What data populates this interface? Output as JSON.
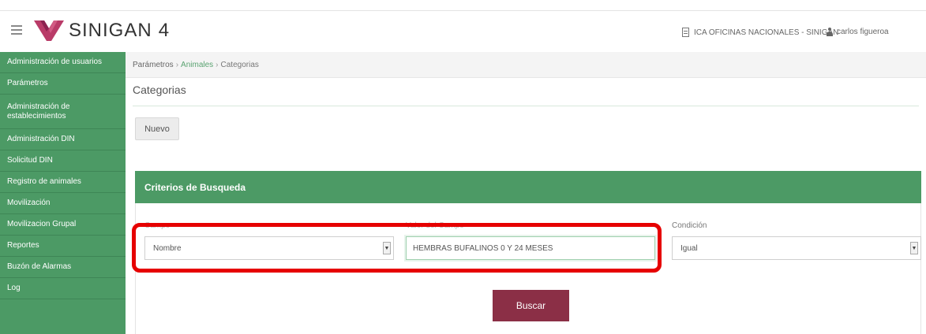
{
  "app": {
    "brand": "SINIGAN",
    "version": "4",
    "office": "ICA OFICINAS NACIONALES - SINIGAN",
    "user": "carlos figueroa"
  },
  "sidebar": {
    "items": [
      {
        "label": "Administración de usuarios"
      },
      {
        "label": "Parámetros"
      },
      {
        "label": "Administración de establecimientos"
      },
      {
        "label": "Administración DIN"
      },
      {
        "label": "Solicitud DIN"
      },
      {
        "label": "Registro de animales"
      },
      {
        "label": "Movilización"
      },
      {
        "label": "Movilizacion Grupal"
      },
      {
        "label": "Reportes"
      },
      {
        "label": "Buzón de Alarmas"
      },
      {
        "label": "Log"
      }
    ]
  },
  "breadcrumb": {
    "root": "Parámetros",
    "middle": "Animales",
    "current": "Categorias",
    "separator": "›"
  },
  "page": {
    "title": "Categorias",
    "new_button": "Nuevo"
  },
  "search": {
    "panel_title": "Criterios de Busqueda",
    "field_label": "Campo",
    "field_value": "Nombre",
    "value_label": "Valor del Campo",
    "value_text": "HEMBRAS BUFALINOS 0 Y 24 MESES",
    "condition_label": "Condición",
    "condition_value": "Igual",
    "search_button": "Buscar"
  },
  "colors": {
    "green": "#4c9a65",
    "button_maroon": "#8b2f46",
    "highlight_red": "#e60000"
  },
  "icons": {
    "menu": "hamburger-icon",
    "logo": "sinigan-logo",
    "office": "office-icon",
    "user": "user-icon",
    "dropdown": "dropdown-arrow-icon"
  }
}
